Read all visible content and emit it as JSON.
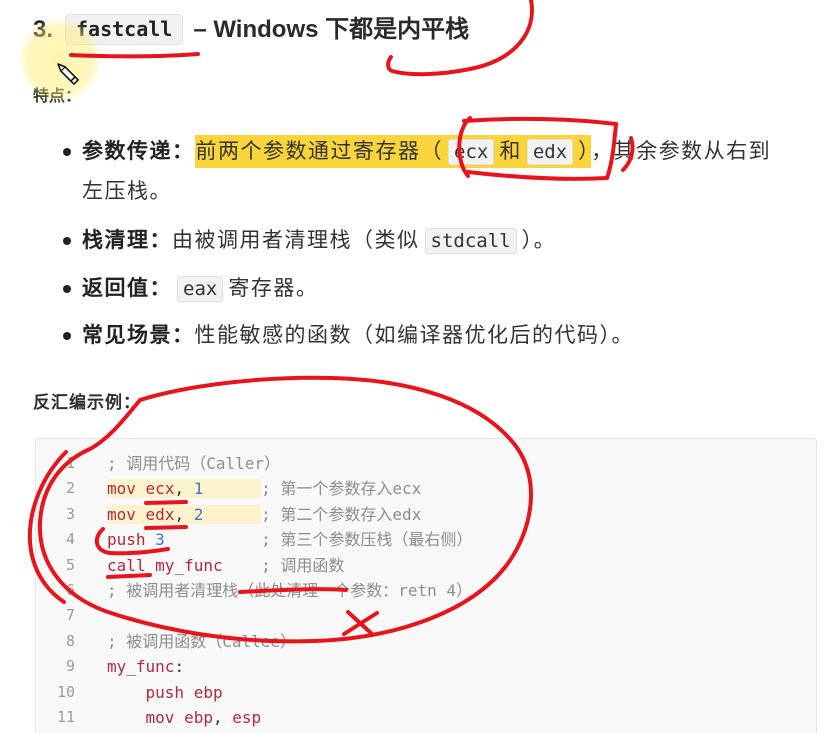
{
  "document": {
    "heading": {
      "number": "3.",
      "code": "fastcall",
      "title": "– Windows 下都是内平栈"
    },
    "features_label": "特点：",
    "bullets": {
      "params": {
        "label": "参数传递：",
        "highlight_text": "前两个参数通过寄存器（",
        "code_1": "ecx",
        "joiner": "和",
        "code_2": "edx",
        "highlight_close": "）",
        "tail_line_1": "，其余参数从右到",
        "tail_line_2": "左压栈。"
      },
      "cleanup": {
        "label": "栈清理：",
        "text": "由被调用者清理栈（类似",
        "code": "stdcall",
        "tail": "）。"
      },
      "return_value": {
        "label": "返回值：",
        "code": "eax",
        "text": "寄存器。"
      },
      "use_case": {
        "label": "常见场景：",
        "text": "性能敏感的函数（如编译器优化后的代码）。"
      }
    },
    "example_label": "反汇编示例：",
    "code_block": {
      "lines": [
        {
          "n": "1",
          "tokens": [],
          "comment": "; 调用代码（Caller）"
        },
        {
          "n": "2",
          "highlight": true,
          "tokens": [
            {
              "t": "mov",
              "kind": "instr"
            },
            {
              "t": " ",
              "kind": "ws"
            },
            {
              "t": "ecx",
              "kind": "reg"
            },
            {
              "t": ", ",
              "kind": "punct"
            },
            {
              "t": "1",
              "kind": "num"
            },
            {
              "t": "      ",
              "kind": "ws"
            }
          ],
          "comment": "; 第一个参数存入ecx"
        },
        {
          "n": "3",
          "highlight": true,
          "tokens": [
            {
              "t": "mov",
              "kind": "instr"
            },
            {
              "t": " ",
              "kind": "ws"
            },
            {
              "t": "edx",
              "kind": "reg"
            },
            {
              "t": ", ",
              "kind": "punct"
            },
            {
              "t": "2",
              "kind": "num"
            },
            {
              "t": "      ",
              "kind": "ws"
            }
          ],
          "comment": "; 第二个参数存入edx"
        },
        {
          "n": "4",
          "tokens": [
            {
              "t": "push",
              "kind": "instr"
            },
            {
              "t": " ",
              "kind": "ws"
            },
            {
              "t": "3",
              "kind": "num"
            },
            {
              "t": "          ",
              "kind": "ws"
            }
          ],
          "comment": "; 第三个参数压栈（最右侧）"
        },
        {
          "n": "5",
          "tokens": [
            {
              "t": "call",
              "kind": "instr"
            },
            {
              "t": " ",
              "kind": "ws"
            },
            {
              "t": "my_func",
              "kind": "label"
            },
            {
              "t": "    ",
              "kind": "ws"
            }
          ],
          "comment": "; 调用函数"
        },
        {
          "n": "6",
          "tokens": [],
          "comment": "; 被调用者清理栈（此处清理一个参数：retn 4）"
        },
        {
          "n": "7",
          "tokens": []
        },
        {
          "n": "8",
          "tokens": [],
          "comment": "; 被调用函数（Callee）"
        },
        {
          "n": "9",
          "tokens": [
            {
              "t": "my_func",
              "kind": "label"
            },
            {
              "t": ":",
              "kind": "punct"
            }
          ]
        },
        {
          "n": "10",
          "tokens": [
            {
              "t": "    ",
              "kind": "ws"
            },
            {
              "t": "push",
              "kind": "instr"
            },
            {
              "t": " ",
              "kind": "ws"
            },
            {
              "t": "ebp",
              "kind": "reg"
            }
          ]
        },
        {
          "n": "11",
          "tokens": [
            {
              "t": "    ",
              "kind": "ws"
            },
            {
              "t": "mov",
              "kind": "instr"
            },
            {
              "t": " ",
              "kind": "ws"
            },
            {
              "t": "ebp",
              "kind": "reg"
            },
            {
              "t": ", ",
              "kind": "punct"
            },
            {
              "t": "esp",
              "kind": "reg"
            }
          ]
        }
      ]
    }
  },
  "colors": {
    "text_highlight": "#f9d43a",
    "line_highlight": "#fbf3cc",
    "keyword": "#b4283c",
    "number": "#3b78c4",
    "comment": "#8d8d8d",
    "code_bg": "#f8f8f8",
    "annotation": "#e8141c"
  },
  "icons": {
    "cursor": "pencil-cursor-icon"
  }
}
